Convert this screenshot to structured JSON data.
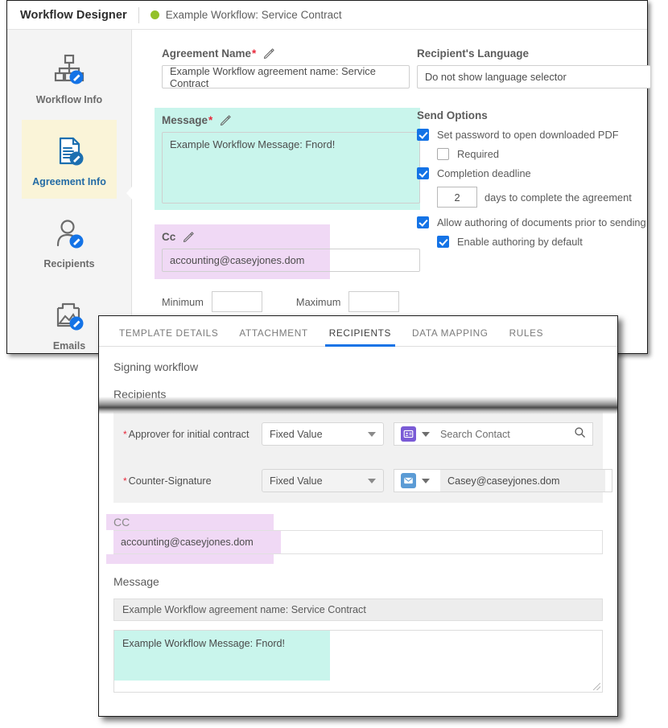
{
  "designer": {
    "title": "Workflow Designer",
    "workflow_name": "Example Workflow: Service Contract",
    "status_color": "#93c12b",
    "sidebar": {
      "items": [
        {
          "label": "Workflow Info",
          "icon": "org-chart-edit-icon",
          "active": false
        },
        {
          "label": "Agreement Info",
          "icon": "document-edit-icon",
          "active": true
        },
        {
          "label": "Recipients",
          "icon": "person-edit-icon",
          "active": false
        },
        {
          "label": "Emails",
          "icon": "mail-image-edit-icon",
          "active": false
        }
      ],
      "active_highlight_color": "#faf4d8"
    },
    "form": {
      "agreement_name": {
        "label": "Agreement Name",
        "required_mark": "*",
        "value": "Example Workflow agreement name: Service Contract"
      },
      "message": {
        "label": "Message",
        "required_mark": "*",
        "value": "Example Workflow Message: Fnord!",
        "highlight_color": "#c9f5ec"
      },
      "cc": {
        "label": "Cc",
        "value": "accounting@caseyjones.dom",
        "highlight_color": "#f0d9f5"
      },
      "minimum_label": "Minimum",
      "minimum_value": "",
      "maximum_label": "Maximum",
      "maximum_value": "",
      "recipients_language": {
        "label": "Recipient's Language",
        "value": "Do not show language selector"
      },
      "send_options": {
        "title": "Send Options",
        "options": [
          {
            "label": "Set password to open downloaded PDF",
            "checked": true,
            "indent": false
          },
          {
            "label": "Required",
            "checked": false,
            "indent": true
          },
          {
            "label": "Completion deadline",
            "checked": true,
            "indent": false
          },
          {
            "label": "Allow authoring of documents prior to sending",
            "checked": true,
            "indent": false
          },
          {
            "label": "Enable authoring by default",
            "checked": true,
            "indent": true
          }
        ],
        "deadline_days": "2",
        "deadline_suffix": "days to complete the agreement"
      }
    }
  },
  "overlay": {
    "tabs": [
      {
        "label": "TEMPLATE DETAILS",
        "active": false
      },
      {
        "label": "ATTACHMENT",
        "active": false
      },
      {
        "label": "RECIPIENTS",
        "active": true
      },
      {
        "label": "DATA MAPPING",
        "active": false
      },
      {
        "label": "RULES",
        "active": false
      }
    ],
    "active_tab_color": "#1473e6",
    "signing_workflow_heading": "Signing workflow",
    "recipients_heading": "Recipients",
    "recipient_rows": [
      {
        "required_mark": "*",
        "label": "Approver for initial contract",
        "value_type": "Fixed Value",
        "icon": "contact-card-icon",
        "icon_color": "#7a5bd6",
        "contact_placeholder": "Search Contact",
        "contact_value": "",
        "has_search_icon": true
      },
      {
        "required_mark": "*",
        "label": "Counter-Signature",
        "value_type": "Fixed Value",
        "icon": "envelope-icon",
        "icon_color": "#5b9bd5",
        "contact_placeholder": "",
        "contact_value": "Casey@caseyjones.dom",
        "has_search_icon": false
      }
    ],
    "cc": {
      "label": "CC",
      "value": "accounting@caseyjones.dom",
      "highlight_color": "#f0d9f5"
    },
    "message": {
      "label": "Message",
      "subject_value": "Example Workflow agreement name: Service Contract",
      "body_value": "Example Workflow Message: Fnord!",
      "highlight_color": "#c9f5ec"
    }
  }
}
